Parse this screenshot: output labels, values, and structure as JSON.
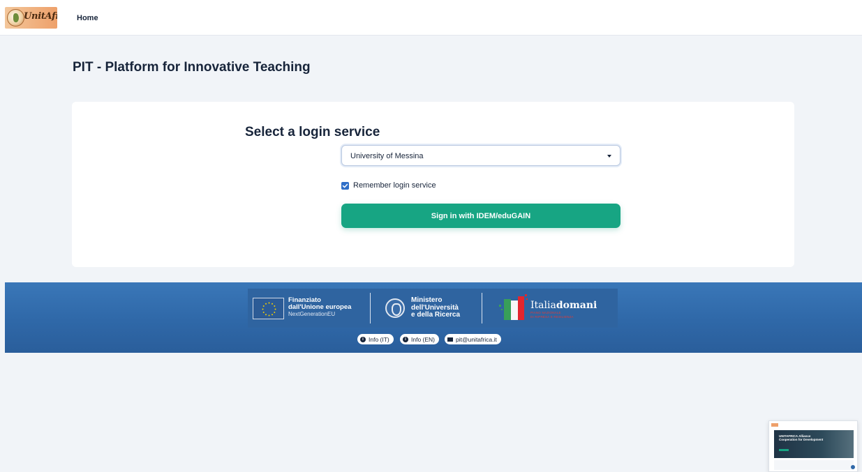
{
  "header": {
    "logo_text": "UnitAfrica",
    "nav_home": "Home"
  },
  "page": {
    "title": "PIT - Platform for Innovative Teaching"
  },
  "login": {
    "heading": "Select a login service",
    "selected_service": "University of Messina",
    "remember_label": "Remember login service",
    "remember_checked": true,
    "signin_label": "Sign in with IDEM/eduGAIN",
    "accent_color": "#17a583"
  },
  "footer": {
    "eu": {
      "line1": "Finanziato",
      "line2": "dall'Unione europea",
      "line3": "NextGenerationEU"
    },
    "ministry": {
      "line1": "Ministero",
      "line2": "dell'Università",
      "line3": "e della Ricerca"
    },
    "italiadomani": {
      "brand_a": "Italia",
      "brand_b": "domani",
      "sub1": "PIANO NAZIONALE",
      "sub2": "DI RIPRESA E RESILIENZA"
    },
    "links": {
      "info_it": "Info (IT)",
      "info_en": "Info (EN)",
      "email": "pit@unitafrica.it"
    },
    "background_color": "#2f68a8"
  },
  "thumbnail": {
    "line1": "UNITAFRICA Alliance",
    "line2": "Cooperation for Development"
  }
}
